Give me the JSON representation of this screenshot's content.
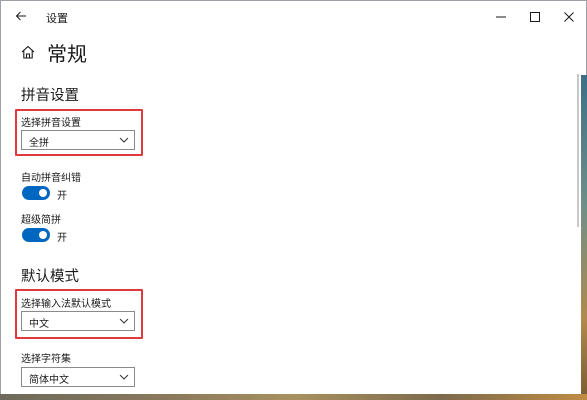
{
  "window": {
    "title": "设置"
  },
  "page": {
    "title": "常规"
  },
  "pinyin_section": {
    "title": "拼音设置",
    "choose_label": "选择拼音设置",
    "choose_value": "全拼",
    "auto_correct_label": "自动拼音纠错",
    "auto_correct_state": "开",
    "super_jianpin_label": "超级简拼",
    "super_jianpin_state": "开"
  },
  "default_mode_section": {
    "title": "默认模式",
    "choose_mode_label": "选择输入法默认模式",
    "choose_mode_value": "中文",
    "charset_label": "选择字符集",
    "charset_value": "简体中文"
  },
  "colors": {
    "accent": "#0067c0",
    "highlight": "#e0393e"
  },
  "icons": {
    "back": "back-arrow-icon",
    "home": "home-icon",
    "minimize": "minimize-icon",
    "maximize": "maximize-icon",
    "close": "close-icon",
    "dropdown": "chevron-down-icon"
  }
}
